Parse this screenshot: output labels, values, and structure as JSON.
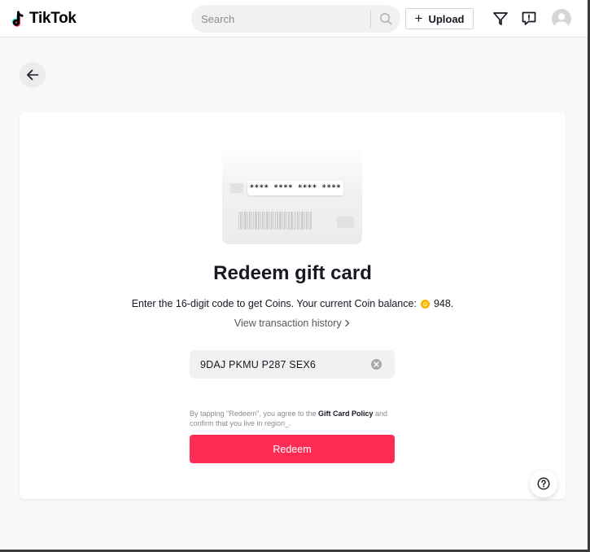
{
  "header": {
    "logo_text": "TikTok",
    "search": {
      "placeholder": "Search",
      "value": ""
    },
    "upload_label": "Upload",
    "upload_icon": "plus-icon",
    "icons": [
      "filter-icon",
      "inbox-icon",
      "avatar"
    ]
  },
  "page": {
    "back_icon": "arrow-left-icon",
    "illustration": {
      "masked_code": "**** **** **** ****"
    },
    "title": "Redeem gift card",
    "description_prefix": "Enter the 16-digit code to get Coins. Your current Coin balance:",
    "coin_balance": "948.",
    "history_link": "View transaction history",
    "code_input": {
      "value": "9DAJ PKMU P287 SEX6"
    },
    "terms_prefix": "By tapping \"Redeem\", you agree to the",
    "terms_policy": "Gift Card Policy",
    "terms_suffix": "and confirm that you live in region_.",
    "redeem_label": "Redeem",
    "help_icon": "question-icon"
  },
  "colors": {
    "accent": "#fe2c55",
    "coin": "#f5b400",
    "background": "#f8f8f8",
    "card": "#ffffff"
  }
}
